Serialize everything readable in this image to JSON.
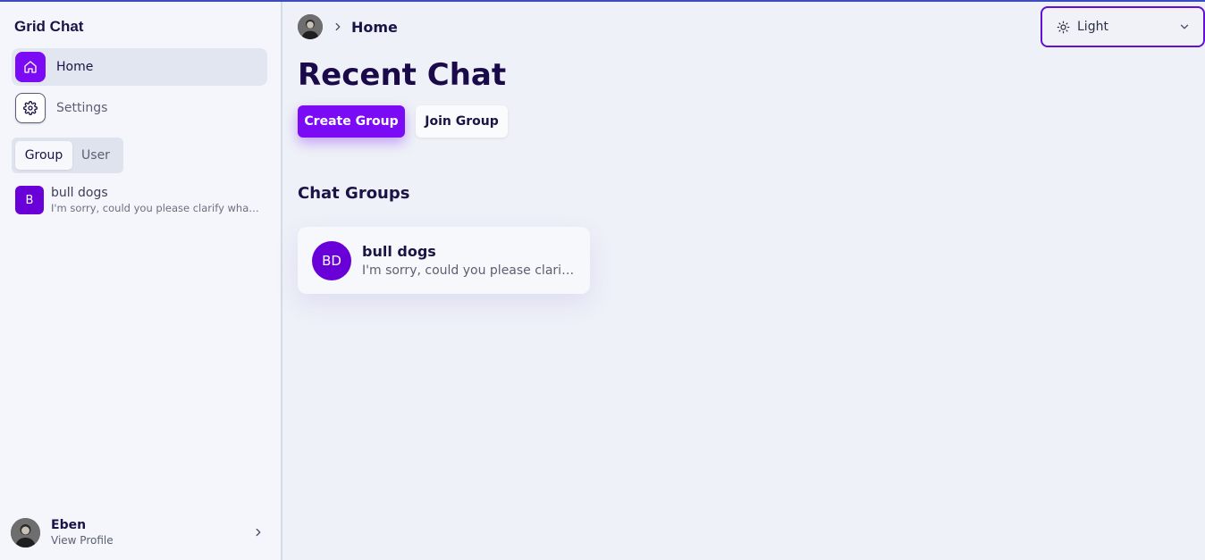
{
  "app": {
    "title": "Grid Chat"
  },
  "sidebar": {
    "nav": [
      {
        "label": "Home",
        "icon": "home-icon",
        "active": true
      },
      {
        "label": "Settings",
        "icon": "gear-icon",
        "active": false
      }
    ],
    "toggle": {
      "options": [
        "Group",
        "User"
      ],
      "selected": "Group"
    },
    "chats": [
      {
        "initial": "B",
        "name": "bull dogs",
        "preview": "I'm sorry, could you please clarify what you mean?"
      }
    ],
    "profile": {
      "name": "Eben",
      "link": "View Profile"
    }
  },
  "header": {
    "breadcrumb": "Home",
    "theme": {
      "selected": "Light",
      "icon": "sun-icon"
    }
  },
  "main": {
    "title": "Recent Chat",
    "buttons": {
      "create": "Create Group",
      "join": "Join Group"
    },
    "section_title": "Chat Groups",
    "groups": [
      {
        "initials": "BD",
        "name": "bull dogs",
        "preview": "I'm sorry, could you please clarify what you mean?"
      }
    ]
  },
  "colors": {
    "accent": "#7c0bf5",
    "avatar": "#6a00d8",
    "focus_ring": "#6210d3"
  }
}
